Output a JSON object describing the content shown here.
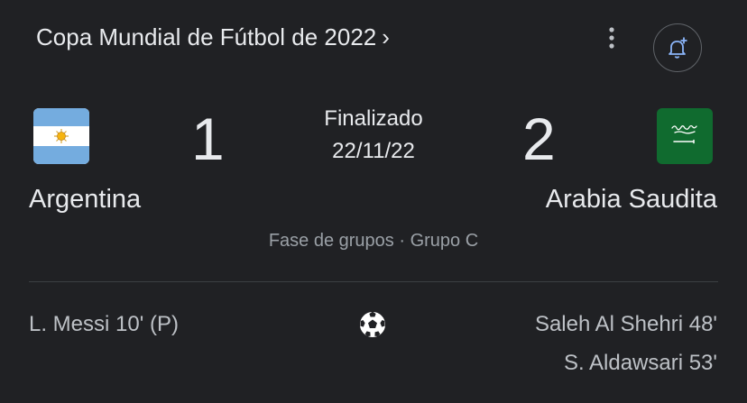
{
  "header": {
    "competition": "Copa Mundial de Fútbol de 2022",
    "chevron": "›",
    "more_icon": "more-vert-icon",
    "alert_icon": "add-alert-icon",
    "accent_color": "#8ab4f8"
  },
  "match": {
    "status": "Finalizado",
    "date": "22/11/22",
    "stage": "Fase de grupos · Grupo C",
    "home": {
      "name": "Argentina",
      "score": "1",
      "flag_icon": "argentina-flag-icon",
      "scorers": [
        "L. Messi 10' (P)"
      ]
    },
    "away": {
      "name": "Arabia Saudita",
      "score": "2",
      "flag_icon": "saudi-arabia-flag-icon",
      "scorers": [
        "Saleh Al Shehri 48'",
        "S. Aldawsari 53'"
      ]
    },
    "goal_icon": "soccer-ball-icon"
  }
}
